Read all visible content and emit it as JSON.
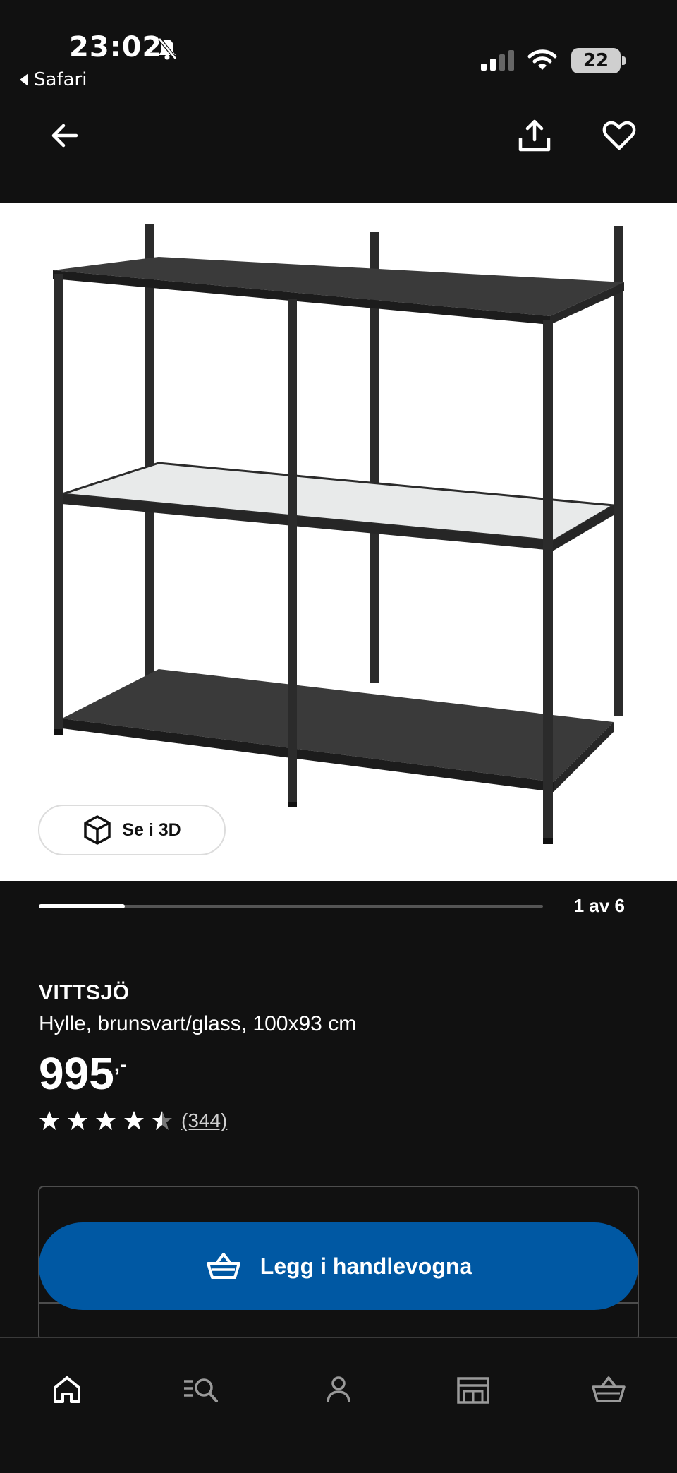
{
  "status_bar": {
    "time": "23:02",
    "back_app": "Safari",
    "battery": "22",
    "icons": [
      "bell-slash-icon",
      "cellular-signal-icon",
      "wifi-icon",
      "battery-icon"
    ]
  },
  "top_nav": {
    "icons": [
      "arrow-left-icon",
      "share-icon",
      "heart-icon"
    ]
  },
  "gallery": {
    "view_3d_label": "Se i 3D",
    "counter": "1 av 6",
    "current": 1,
    "total": 6,
    "progress_fraction": 0.17
  },
  "product": {
    "name": "VITTSJÖ",
    "description": "Hylle, brunsvart/glass, 100x93 cm",
    "price": "995",
    "price_suffix": ",-",
    "rating": 4.5,
    "review_count": "(344)"
  },
  "cta": {
    "label": "Legg i handlevogna",
    "color": "#0058a3"
  },
  "tab_bar": {
    "items": [
      "home-icon",
      "search-list-icon",
      "profile-icon",
      "store-icon",
      "cart-icon"
    ]
  },
  "colors": {
    "background": "#111111",
    "accent": "#0058a3"
  }
}
